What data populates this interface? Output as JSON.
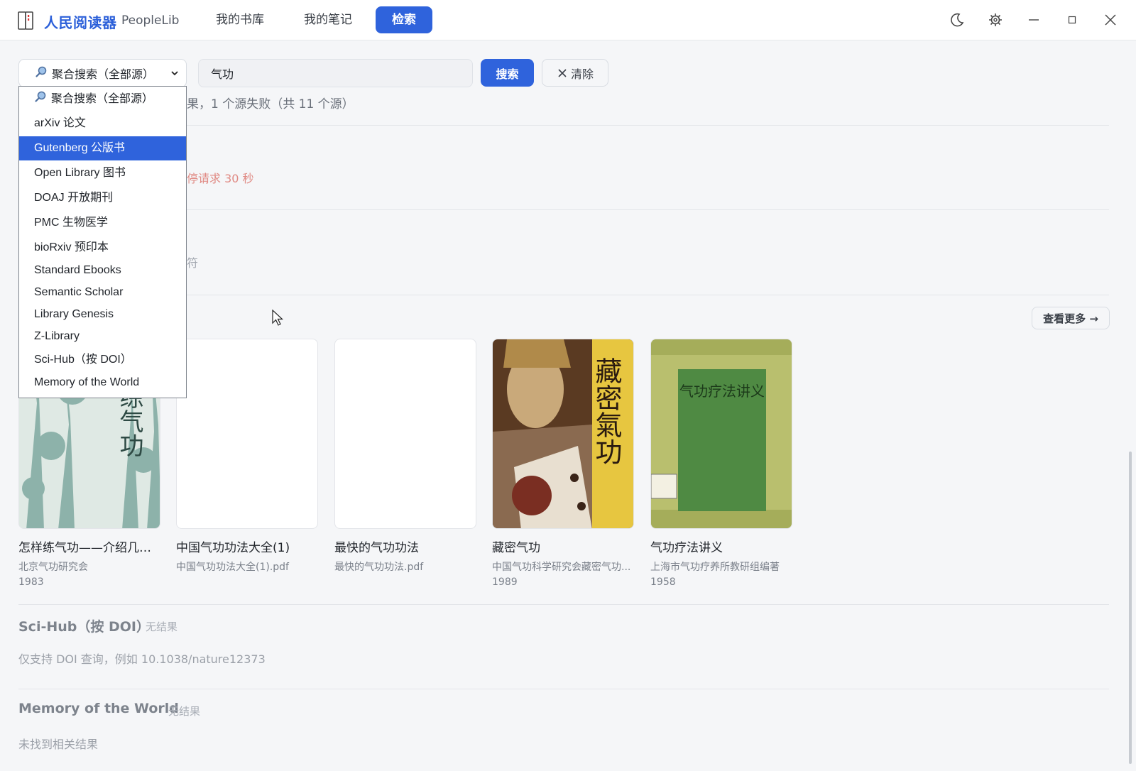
{
  "app": {
    "name": "人民阅读器",
    "subtitle": "PeopleLib"
  },
  "nav": {
    "library": "我的书库",
    "notes": "我的笔记",
    "search": "检索"
  },
  "window_controls": [
    "moon-icon",
    "gear-icon",
    "minimize-icon",
    "maximize-icon",
    "close-icon"
  ],
  "search": {
    "source_selected": "聚合搜索（全部源）",
    "query": "气功",
    "search_button": "搜索",
    "clear_button": "清除"
  },
  "dropdown": {
    "options": [
      "聚合搜索（全部源）",
      "arXiv 论文",
      "Gutenberg 公版书",
      "Open Library 图书",
      "DOAJ 开放期刊",
      "PMC 生物医学",
      "bioRxiv 预印本",
      "Standard Ebooks",
      "Semantic Scholar",
      "Library Genesis",
      "Z-Library",
      "Sci-Hub（按 DOI）",
      "Memory of the World"
    ],
    "highlighted_index": 2
  },
  "results": {
    "summary_fragment": "果，1 个源失败（共 11 个源）",
    "error_fragment": "停请求 30 秒",
    "muted_fragment": "符",
    "more_button": "查看更多 →"
  },
  "books": [
    {
      "title": "怎样练气功——介绍几种...",
      "author": "北京气功研究会",
      "year": "1983",
      "cover": "sketch-trees"
    },
    {
      "title": "中国气功功法大全(1)",
      "author": "中国气功功法大全(1).pdf",
      "year": "",
      "cover": "blank"
    },
    {
      "title": "最快的气功功法",
      "author": "最快的气功功法.pdf",
      "year": "",
      "cover": "blank"
    },
    {
      "title": "藏密气功",
      "author": "中国气功科学研究会藏密气功...",
      "year": "1989",
      "cover": "statue"
    },
    {
      "title": "气功疗法讲义",
      "author": "上海市气功疗养所教研组编著",
      "year": "1958",
      "cover": "green"
    }
  ],
  "covers_text": {
    "book1_vertical": "样练气功",
    "book4_vertical": "藏密氣功",
    "book5_title": "气功疗法讲义"
  },
  "sections": {
    "scihub": {
      "title": "Sci-Hub（按 DOI）",
      "badge": "无结果",
      "note": "仅支持 DOI 查询，例如 10.1038/nature12373"
    },
    "motw": {
      "title": "Memory of the World",
      "badge": "无结果",
      "note": "未找到相关结果"
    }
  },
  "colors": {
    "accent": "#2f63dc",
    "brand_text": "#2b5fd9",
    "error": "#e08a84",
    "background": "#f5f6f8"
  }
}
